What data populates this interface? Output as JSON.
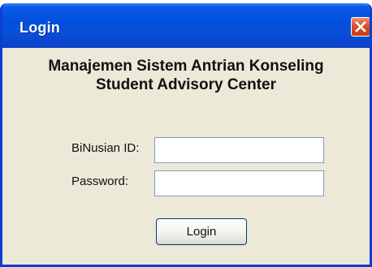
{
  "window": {
    "title": "Login",
    "close_icon": "close-icon",
    "colors": {
      "titlebar": "#0250de",
      "body": "#ece9d8",
      "close": "#d8502c"
    }
  },
  "header": {
    "line1": "Manajemen Sistem Antrian Konseling",
    "line2": "Student Advisory Center"
  },
  "form": {
    "id_label": "BiNusian ID:",
    "id_value": "",
    "password_label": "Password:",
    "password_value": "",
    "submit_label": "Login"
  }
}
